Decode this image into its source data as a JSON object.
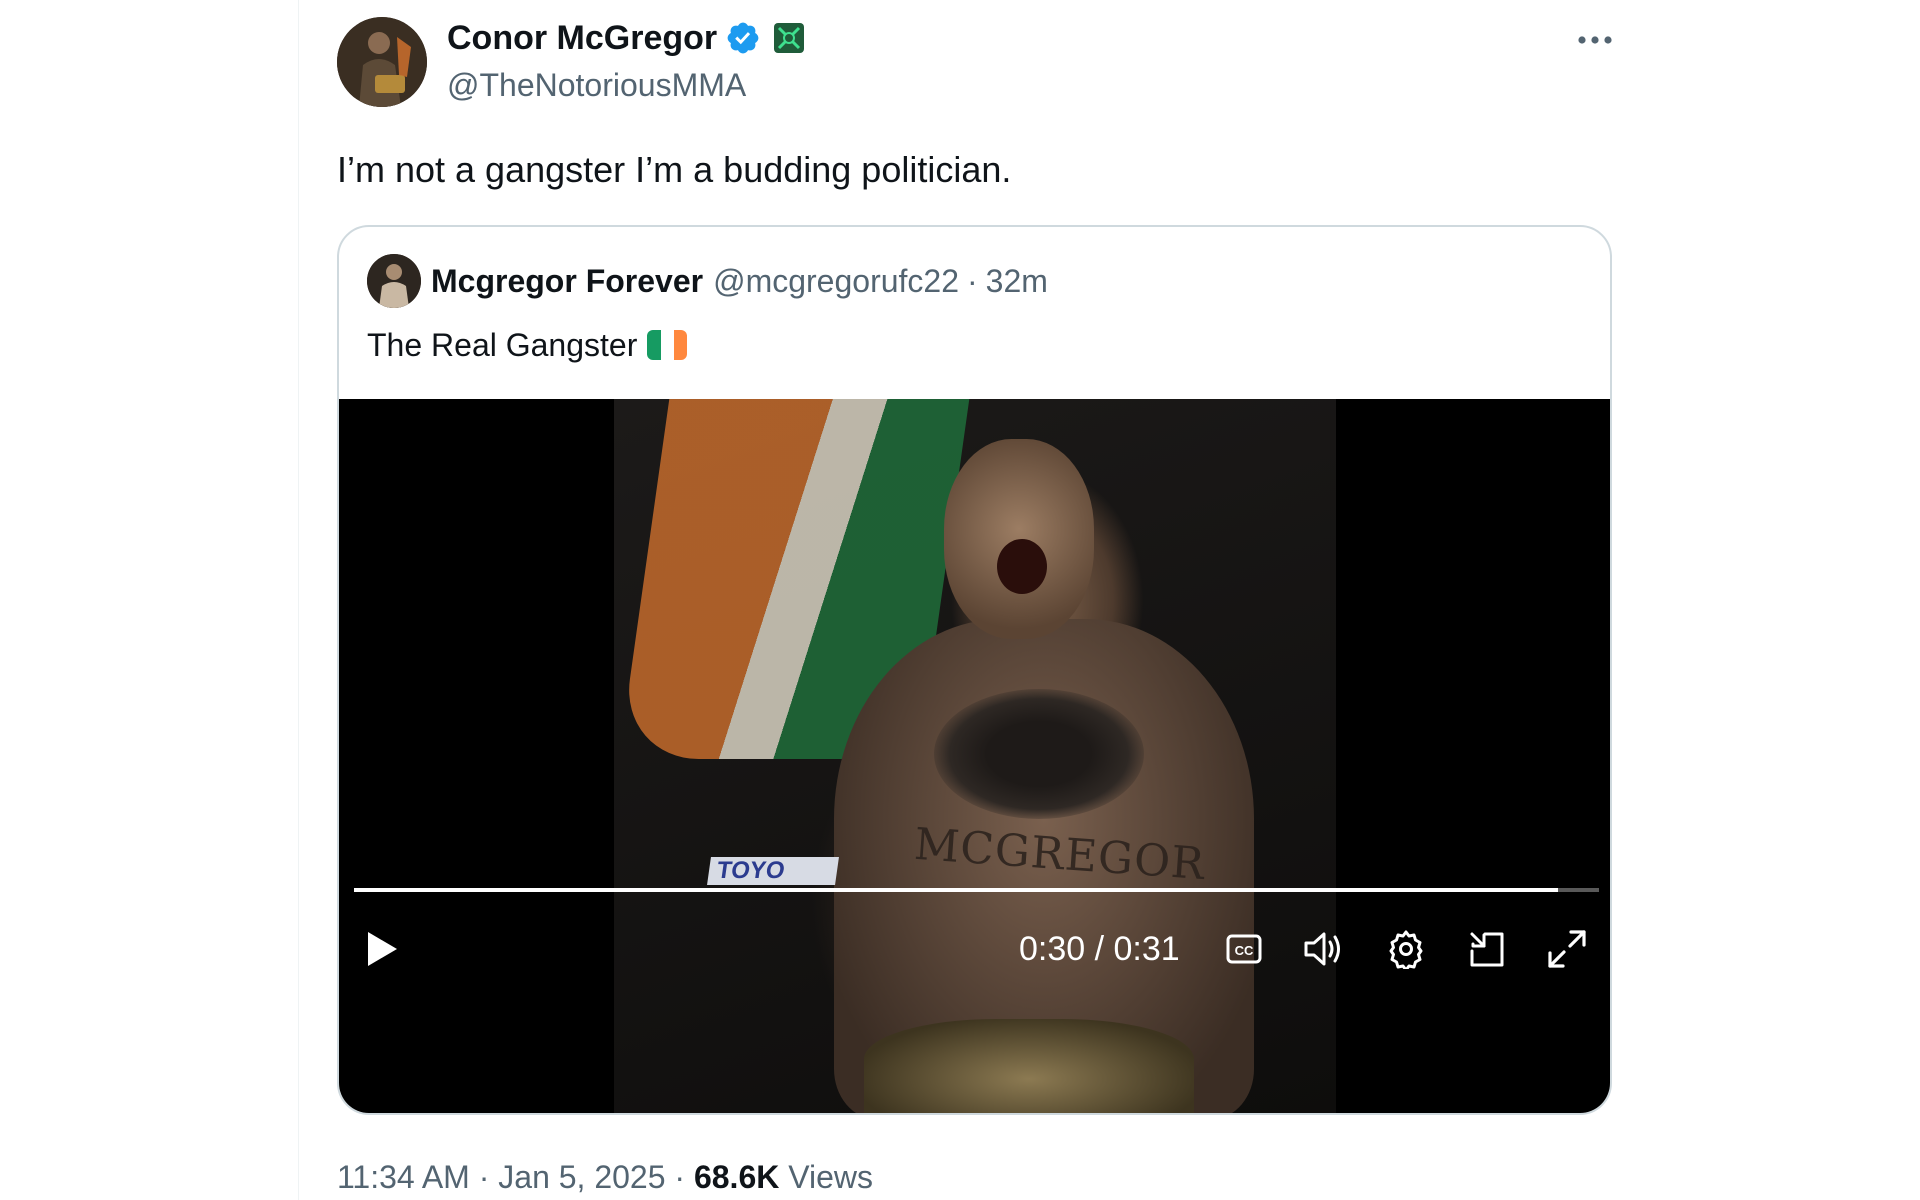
{
  "tweet": {
    "author": {
      "name": "Conor McGregor",
      "handle": "@TheNotoriousMMA"
    },
    "text": "I’m not a gangster I’m a budding politician.",
    "quoted": {
      "name": "Mcgregor Forever",
      "handle": "@mcgregorufc22",
      "separator": "·",
      "time_ago": "32m",
      "text": "The Real Gangster",
      "flag": "ireland-flag-emoji",
      "video": {
        "sponsor_text": "TOYO",
        "tattoo_text": "MCGREGOR",
        "current_time": "0:30",
        "duration": "0:31",
        "time_display": "0:30 / 0:31",
        "progress_fraction": 0.967
      }
    },
    "footer": {
      "time": "11:34 AM",
      "date": "Jan 5, 2025",
      "views_count": "68.6K",
      "views_label": "Views",
      "separator": "·"
    }
  },
  "colors": {
    "text_primary": "#0f1419",
    "text_secondary": "#536471",
    "verified_blue": "#1d9bf0",
    "border": "#cfd9de",
    "flag_green": "#169b62",
    "flag_white": "#ffffff",
    "flag_orange": "#ff883e"
  },
  "icons": {
    "verified": "verified-badge-icon",
    "affiliation": "affiliation-badge-icon",
    "more": "more-options-icon",
    "play": "play-icon",
    "captions": "closed-captions-icon",
    "volume": "volume-icon",
    "settings": "gear-icon",
    "pip": "picture-in-picture-icon",
    "fullscreen": "fullscreen-icon"
  }
}
